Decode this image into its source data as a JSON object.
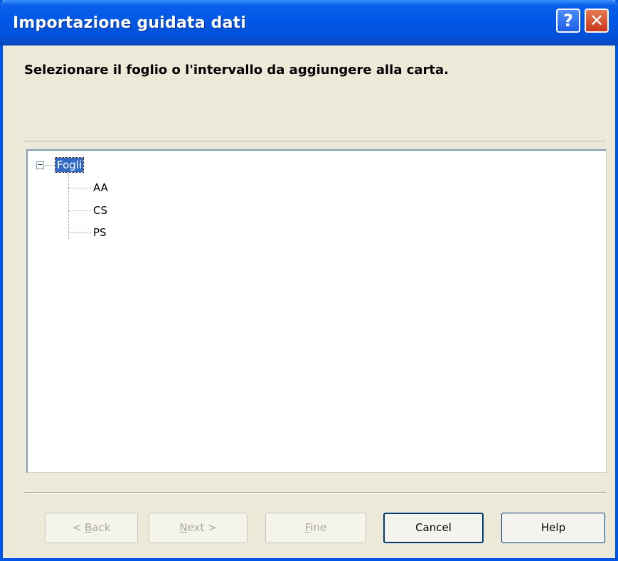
{
  "window": {
    "title": "Importazione guidata dati"
  },
  "titlebar_buttons": {
    "help_label": "?",
    "close_label": "✕"
  },
  "header": {
    "instruction": "Selezionare il foglio o l'intervallo da aggiungere alla carta."
  },
  "tree": {
    "root": {
      "label": "Fogli",
      "expanded": true,
      "expander_glyph": "−",
      "selected": true
    },
    "children": [
      {
        "label": "AA"
      },
      {
        "label": "CS"
      },
      {
        "label": "PS"
      }
    ]
  },
  "buttons": {
    "back": {
      "prefix": "< ",
      "mnemonic": "B",
      "rest": "ack",
      "enabled": false
    },
    "next": {
      "mnemonic": "N",
      "rest": "ext >",
      "enabled": false
    },
    "finish": {
      "mnemonic": "F",
      "rest": "ine",
      "enabled": false
    },
    "cancel": {
      "label": "Cancel",
      "enabled": true
    },
    "help": {
      "label": "Help",
      "enabled": true
    }
  },
  "colors": {
    "titlebar": "#0058e6",
    "selection": "#316ac5",
    "dialog_bg": "#ece9d8",
    "close": "#c9361b"
  }
}
